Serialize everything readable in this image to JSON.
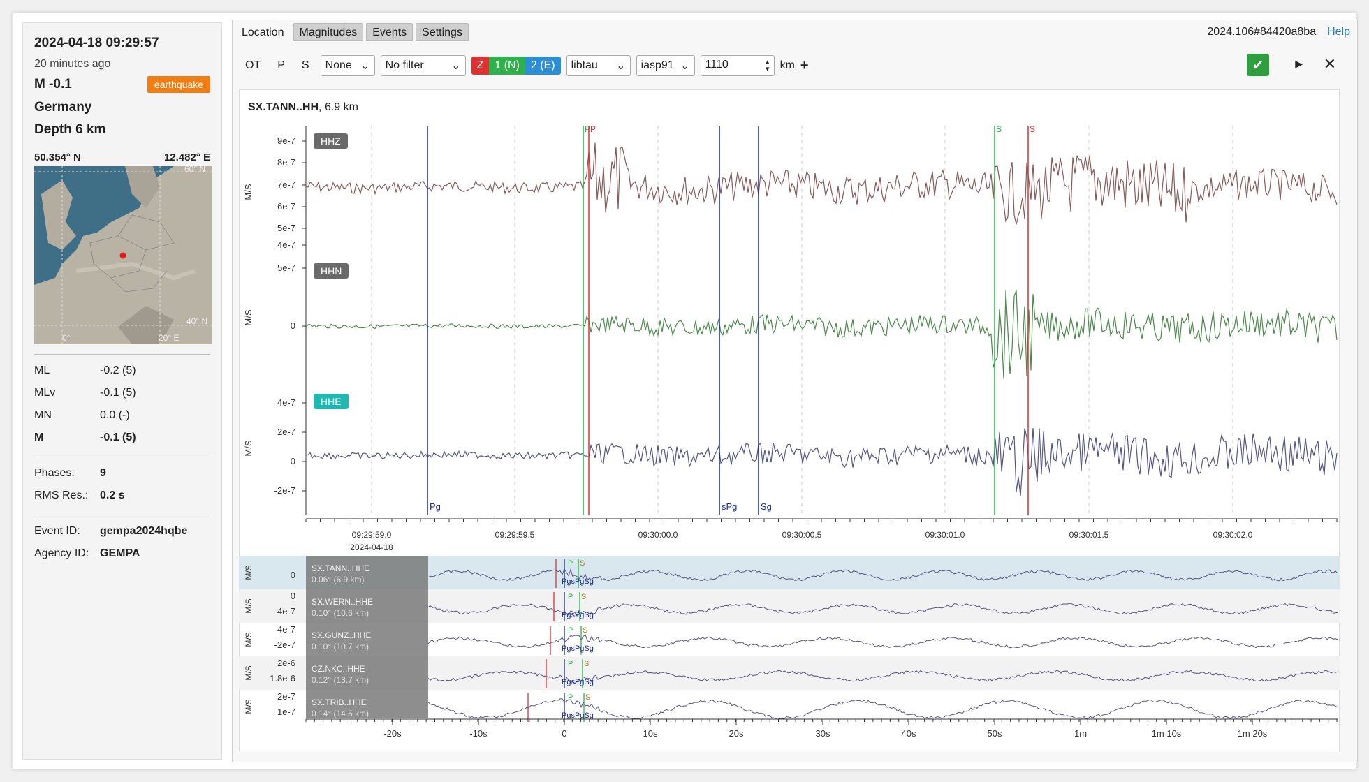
{
  "event": {
    "time": "2024-04-18 09:29:57",
    "ago": "20 minutes ago",
    "magnitude": "M -0.1",
    "type": "earthquake",
    "region": "Germany",
    "depth": "Depth 6 km",
    "lat": "50.354° N",
    "lon": "12.482° E",
    "map_labels": {
      "lat60": "60° N",
      "lat40": "40° N",
      "lon0": "0°",
      "lon20": "20° E"
    }
  },
  "magnitudes": [
    {
      "type": "ML",
      "value": "-0.2 (5)"
    },
    {
      "type": "MLv",
      "value": "-0.1 (5)"
    },
    {
      "type": "MN",
      "value": "0.0 (-)"
    },
    {
      "type": "M",
      "value": "-0.1 (5)"
    }
  ],
  "stats": {
    "phases_label": "Phases:",
    "phases": "9",
    "rms_label": "RMS Res.:",
    "rms": "0.2 s"
  },
  "ids": {
    "event_label": "Event ID:",
    "event": "gempa2024hqbe",
    "agency_label": "Agency ID:",
    "agency": "GEMPA"
  },
  "tabs": [
    "Location",
    "Magnitudes",
    "Events",
    "Settings"
  ],
  "version": "2024.106#84420a8ba",
  "help": "Help",
  "toolbar": {
    "ot": "OT",
    "p": "P",
    "s": "S",
    "filter_none": "None",
    "filter": "No filter",
    "chan_z": "Z",
    "chan_n": "1 (N)",
    "chan_e": "2 (E)",
    "model": "libtau",
    "table": "iasp91",
    "distance": "1110",
    "unit": "km",
    "add": "+"
  },
  "trace": {
    "station": "SX.TANN..HH",
    "distance": ", 6.9 km",
    "units": "M/S",
    "channels": [
      "HHZ",
      "HHN",
      "HHE"
    ],
    "hhz_ticks": [
      "9e-7",
      "8e-7",
      "7e-7",
      "6e-7",
      "5e-7",
      "4e-7"
    ],
    "hhn_ticks": [
      "5e-7",
      "0"
    ],
    "hhe_ticks": [
      "4e-7",
      "2e-7",
      "0",
      "-2e-7"
    ],
    "time_ticks": [
      "09:29:59.0",
      "09:29:59.5",
      "09:30:00.0",
      "09:30:00.5",
      "09:30:01.0",
      "09:30:01.5",
      "09:30:02.0"
    ],
    "date": "2024-04-18",
    "picks": [
      "Pg",
      "sPg",
      "Sg",
      "P",
      "P",
      "S",
      "S"
    ]
  },
  "stations": [
    {
      "name": "SX.TANN..HHE",
      "dist": "0.06° (6.9 km)",
      "ticks": [
        "0"
      ]
    },
    {
      "name": "SX.WERN..HHE",
      "dist": "0.10° (10.6 km)",
      "ticks": [
        "0",
        "-4e-7"
      ]
    },
    {
      "name": "SX.GUNZ..HHE",
      "dist": "0.10° (10.7 km)",
      "ticks": [
        "4e-7",
        "-2e-7"
      ]
    },
    {
      "name": "CZ.NKC..HHE",
      "dist": "0.12° (13.7 km)",
      "ticks": [
        "2e-6",
        "1.8e-6"
      ]
    },
    {
      "name": "SX.TRIB..HHE",
      "dist": "0.14° (14.5 km)",
      "ticks": [
        "2e-7",
        "1e-7"
      ]
    }
  ],
  "station_picks": [
    "Pg",
    "sPg",
    "Sg",
    "P",
    "S"
  ],
  "bottom_ticks": [
    "-20s",
    "-10s",
    "0",
    "10s",
    "20s",
    "30s",
    "40s",
    "50s",
    "1m",
    "1m 10s",
    "1m 20s"
  ],
  "colors": {
    "accent": "#f07e14",
    "z": "#e03030",
    "n": "#2eb04a",
    "e": "#2a8fd6",
    "hhz": "#8a5a5a",
    "hhn": "#4a8a4a",
    "hhe": "#55558a"
  }
}
